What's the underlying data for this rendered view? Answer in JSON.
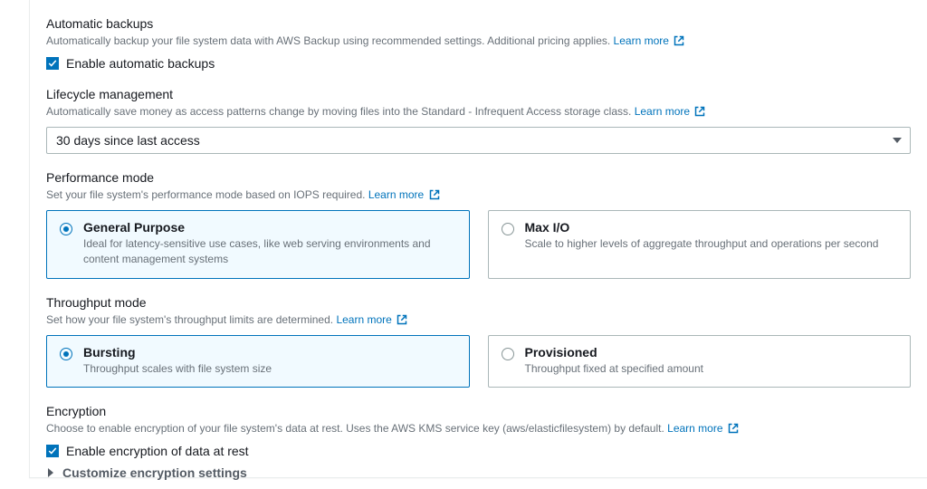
{
  "backups": {
    "title": "Automatic backups",
    "desc": "Automatically backup your file system data with AWS Backup using recommended settings. Additional pricing applies.",
    "learn": "Learn more",
    "checkbox_label": "Enable automatic backups",
    "checked": true
  },
  "lifecycle": {
    "title": "Lifecycle management",
    "desc": "Automatically save money as access patterns change by moving files into the Standard - Infrequent Access storage class.",
    "learn": "Learn more",
    "select_value": "30 days since last access"
  },
  "performance": {
    "title": "Performance mode",
    "desc": "Set your file system's performance mode based on IOPS required.",
    "learn": "Learn more",
    "options": [
      {
        "title": "General Purpose",
        "desc": "Ideal for latency-sensitive use cases, like web serving environments and content management systems",
        "selected": true
      },
      {
        "title": "Max I/O",
        "desc": "Scale to higher levels of aggregate throughput and operations per second",
        "selected": false
      }
    ]
  },
  "throughput": {
    "title": "Throughput mode",
    "desc": "Set how your file system's throughput limits are determined.",
    "learn": "Learn more",
    "options": [
      {
        "title": "Bursting",
        "desc": "Throughput scales with file system size",
        "selected": true
      },
      {
        "title": "Provisioned",
        "desc": "Throughput fixed at specified amount",
        "selected": false
      }
    ]
  },
  "encryption": {
    "title": "Encryption",
    "desc": "Choose to enable encryption of your file system's data at rest. Uses the AWS KMS service key (aws/elasticfilesystem) by default.",
    "learn": "Learn more",
    "checkbox_label": "Enable encryption of data at rest",
    "checked": true,
    "expand_label": "Customize encryption settings"
  }
}
